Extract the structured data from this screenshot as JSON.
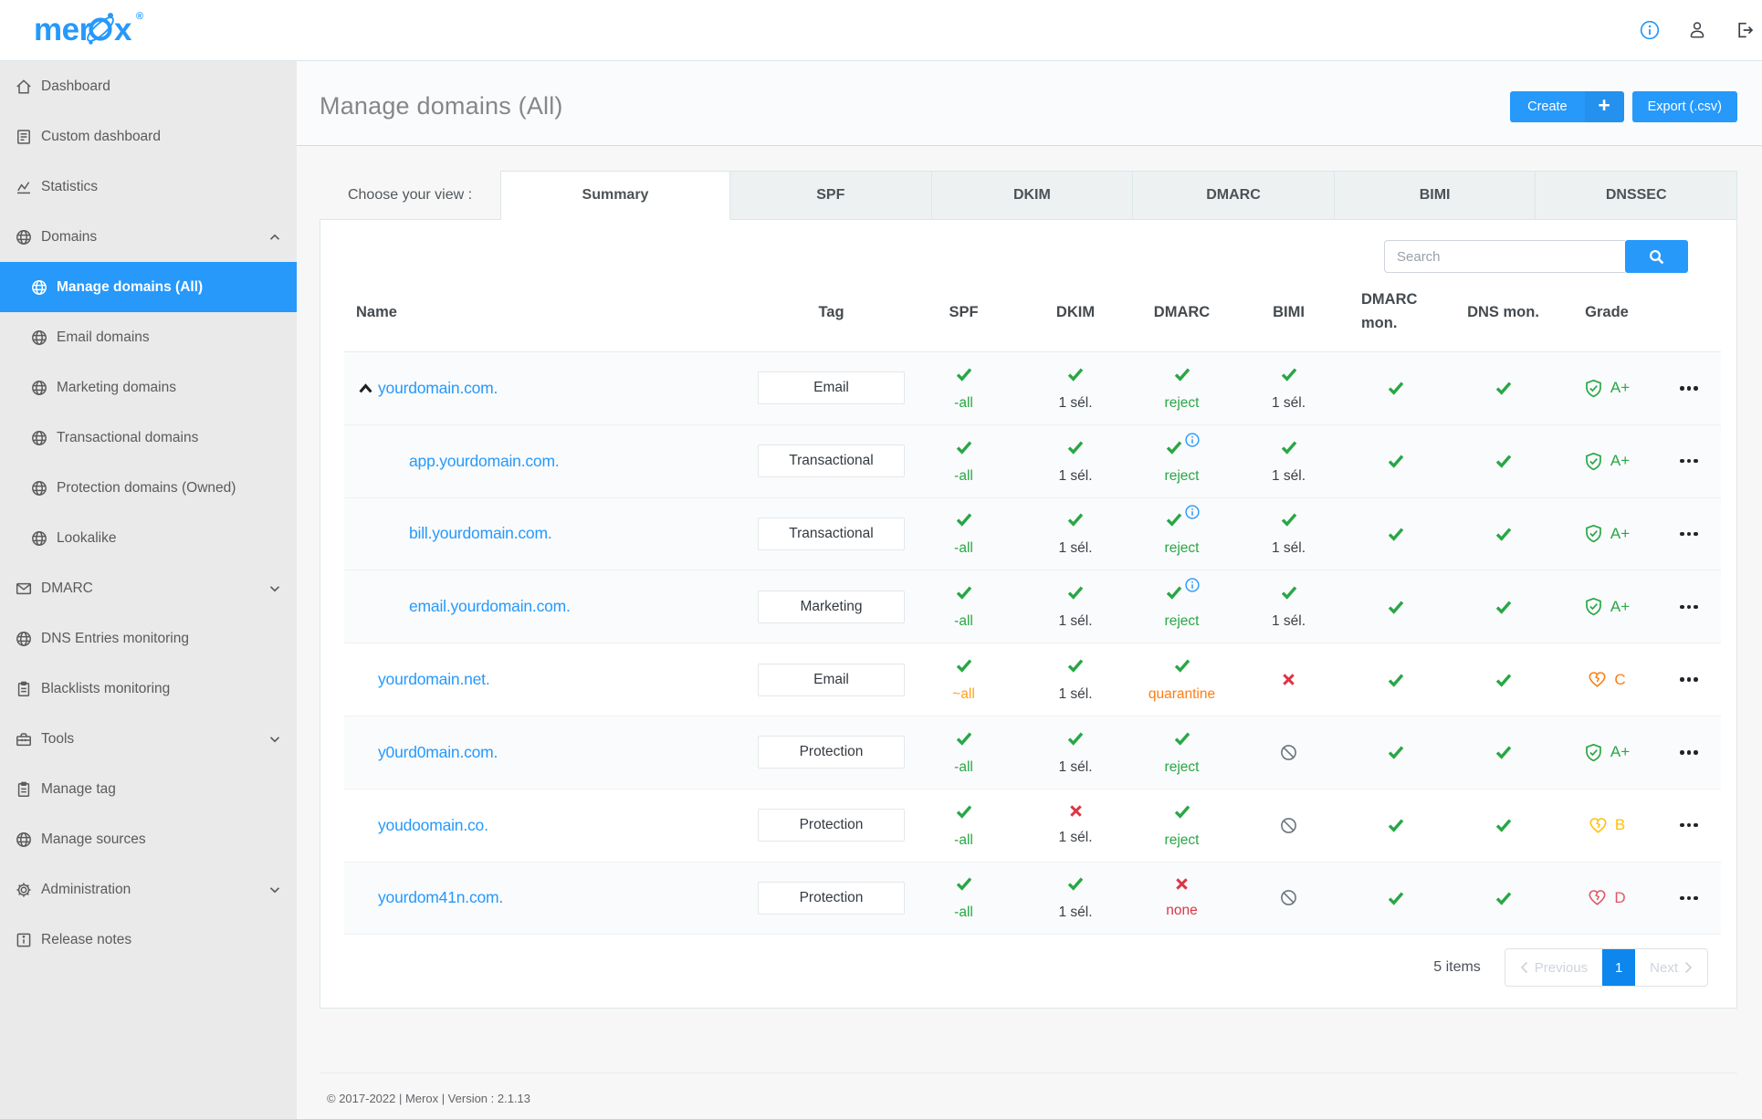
{
  "brand": {
    "name": "merox",
    "logo_left": "mer",
    "logo_right": "x",
    "registered": "®"
  },
  "header": {
    "icons": [
      "info-icon",
      "user-icon",
      "logout-icon"
    ]
  },
  "sidebar": {
    "items": [
      {
        "label": "Dashboard",
        "icon": "home"
      },
      {
        "label": "Custom dashboard",
        "icon": "doc"
      },
      {
        "label": "Statistics",
        "icon": "stats"
      },
      {
        "label": "Domains",
        "icon": "globe",
        "chevron": "up"
      },
      {
        "label": "Manage domains (All)",
        "icon": "globe",
        "child": true,
        "active": true
      },
      {
        "label": "Email domains",
        "icon": "globe",
        "child": true
      },
      {
        "label": "Marketing domains",
        "icon": "globe",
        "child": true
      },
      {
        "label": "Transactional domains",
        "icon": "globe",
        "child": true
      },
      {
        "label": "Protection domains (Owned)",
        "icon": "globe",
        "child": true
      },
      {
        "label": "Lookalike",
        "icon": "globe",
        "child": true
      },
      {
        "label": "DMARC",
        "icon": "mail",
        "chevron": "down"
      },
      {
        "label": "DNS Entries monitoring",
        "icon": "globe"
      },
      {
        "label": "Blacklists monitoring",
        "icon": "clipboard"
      },
      {
        "label": "Tools",
        "icon": "toolbox",
        "chevron": "down"
      },
      {
        "label": "Manage tag",
        "icon": "clipboard"
      },
      {
        "label": "Manage sources",
        "icon": "globe"
      },
      {
        "label": "Administration",
        "icon": "gear",
        "chevron": "down"
      },
      {
        "label": "Release notes",
        "icon": "infosq"
      }
    ]
  },
  "page": {
    "title": "Manage domains (All)",
    "create_label": "Create",
    "create_plus": "+",
    "export_label": "Export (.csv)"
  },
  "tabs": {
    "caption": "Choose your view :",
    "active": "Summary",
    "items": [
      "Summary",
      "SPF",
      "DKIM",
      "DMARC",
      "BIMI",
      "DNSSEC"
    ]
  },
  "search": {
    "placeholder": "Search"
  },
  "table": {
    "columns": [
      "Name",
      "Tag",
      "SPF",
      "DKIM",
      "DMARC",
      "BIMI",
      "DMARC mon.",
      "DNS mon.",
      "Grade"
    ],
    "rows": [
      {
        "name": "yourdomain.com.",
        "expander": true,
        "tag": "Email",
        "spf": {
          "i": "check",
          "t": "-all",
          "c": "green"
        },
        "dkim": {
          "i": "check",
          "t": "1 sél.",
          "c": "dark"
        },
        "dmarc": {
          "i": "check",
          "t": "reject",
          "c": "green"
        },
        "bimi": {
          "i": "check",
          "t": "1 sél.",
          "c": "dark"
        },
        "dmarc_mon": "check",
        "dns_mon": "check",
        "grade": {
          "i": "shield",
          "l": "A+",
          "c": "green"
        }
      },
      {
        "name": "app.yourdomain.com.",
        "indent": true,
        "tag": "Transactional",
        "spf": {
          "i": "check",
          "t": "-all",
          "c": "green"
        },
        "dkim": {
          "i": "check",
          "t": "1 sél.",
          "c": "dark"
        },
        "dmarc": {
          "i": "check-info",
          "t": "reject",
          "c": "green"
        },
        "bimi": {
          "i": "check",
          "t": "1 sél.",
          "c": "dark"
        },
        "dmarc_mon": "check",
        "dns_mon": "check",
        "grade": {
          "i": "shield",
          "l": "A+",
          "c": "green"
        }
      },
      {
        "name": "bill.yourdomain.com.",
        "indent": true,
        "tag": "Transactional",
        "spf": {
          "i": "check",
          "t": "-all",
          "c": "green"
        },
        "dkim": {
          "i": "check",
          "t": "1 sél.",
          "c": "dark"
        },
        "dmarc": {
          "i": "check-info",
          "t": "reject",
          "c": "green"
        },
        "bimi": {
          "i": "check",
          "t": "1 sél.",
          "c": "dark"
        },
        "dmarc_mon": "check",
        "dns_mon": "check",
        "grade": {
          "i": "shield",
          "l": "A+",
          "c": "green"
        }
      },
      {
        "name": "email.yourdomain.com.",
        "indent": true,
        "tag": "Marketing",
        "spf": {
          "i": "check",
          "t": "-all",
          "c": "green"
        },
        "dkim": {
          "i": "check",
          "t": "1 sél.",
          "c": "dark"
        },
        "dmarc": {
          "i": "check-info",
          "t": "reject",
          "c": "green"
        },
        "bimi": {
          "i": "check",
          "t": "1 sél.",
          "c": "dark"
        },
        "dmarc_mon": "check",
        "dns_mon": "check",
        "grade": {
          "i": "shield",
          "l": "A+",
          "c": "green"
        }
      },
      {
        "name": "yourdomain.net.",
        "tag": "Email",
        "spf": {
          "i": "check",
          "t": "~all",
          "c": "orange"
        },
        "dkim": {
          "i": "check",
          "t": "1 sél.",
          "c": "dark"
        },
        "dmarc": {
          "i": "check",
          "t": "quarantine",
          "c": "orange2"
        },
        "bimi": {
          "i": "x"
        },
        "dmarc_mon": "check",
        "dns_mon": "check",
        "grade": {
          "i": "heart",
          "l": "C",
          "c": "orange2"
        }
      },
      {
        "name": "y0urd0main.com.",
        "tag": "Protection",
        "spf": {
          "i": "check",
          "t": "-all",
          "c": "green"
        },
        "dkim": {
          "i": "check",
          "t": "1 sél.",
          "c": "dark"
        },
        "dmarc": {
          "i": "check",
          "t": "reject",
          "c": "green"
        },
        "bimi": {
          "i": "slash"
        },
        "dmarc_mon": "check",
        "dns_mon": "check",
        "grade": {
          "i": "shield",
          "l": "A+",
          "c": "green"
        }
      },
      {
        "name": "youdoomain.co.",
        "tag": "Protection",
        "spf": {
          "i": "check",
          "t": "-all",
          "c": "green"
        },
        "dkim": {
          "i": "x",
          "t": "1 sél.",
          "c": "dark"
        },
        "dmarc": {
          "i": "check",
          "t": "reject",
          "c": "green"
        },
        "bimi": {
          "i": "slash"
        },
        "dmarc_mon": "check",
        "dns_mon": "check",
        "grade": {
          "i": "heart",
          "l": "B",
          "c": "yellow"
        }
      },
      {
        "name": "yourdom41n.com.",
        "tag": "Protection",
        "spf": {
          "i": "check",
          "t": "-all",
          "c": "green"
        },
        "dkim": {
          "i": "check",
          "t": "1 sél.",
          "c": "dark"
        },
        "dmarc": {
          "i": "x",
          "t": "none",
          "c": "red"
        },
        "bimi": {
          "i": "slash"
        },
        "dmarc_mon": "check",
        "dns_mon": "check",
        "grade": {
          "i": "heart",
          "l": "D",
          "c": "red2"
        }
      }
    ],
    "pagination": {
      "items_text": "5 items",
      "previous": "Previous",
      "page": "1",
      "next": "Next"
    }
  },
  "footer": {
    "copyright": "© 2017-2022 | Merox | Version : 2.1.13"
  },
  "colors": {
    "accent": "#2699fb",
    "green": "#28a745",
    "red": "#dc3545",
    "orange": "#ffa21a",
    "yellow": "#ffc107",
    "muted": "#6c757d",
    "active_page": "#0d86ee"
  }
}
